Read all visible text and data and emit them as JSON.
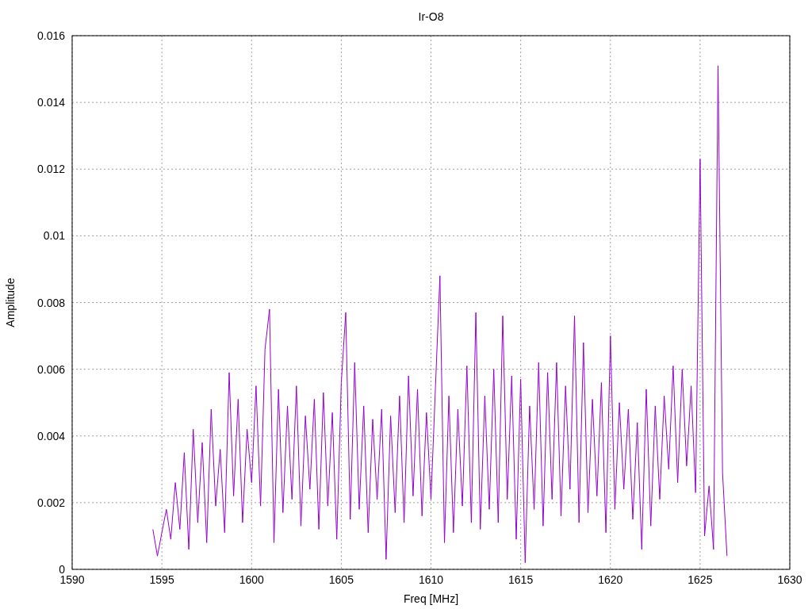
{
  "chart_data": {
    "type": "line",
    "grid": true,
    "title": "Ir-O8",
    "xlabel": "Freq [MHz]",
    "ylabel": "Amplitude",
    "xlim": [
      1590,
      1630
    ],
    "ylim": [
      0,
      0.016
    ],
    "xticks": [
      1590,
      1595,
      1600,
      1605,
      1610,
      1615,
      1620,
      1625,
      1630
    ],
    "yticks": [
      {
        "value": 0,
        "label": "0"
      },
      {
        "value": 0.002,
        "label": "0.002"
      },
      {
        "value": 0.004,
        "label": "0.004"
      },
      {
        "value": 0.006,
        "label": "0.006"
      },
      {
        "value": 0.008,
        "label": "0.008"
      },
      {
        "value": 0.01,
        "label": "0.01"
      },
      {
        "value": 0.012,
        "label": "0.012"
      },
      {
        "value": 0.014,
        "label": "0.014"
      },
      {
        "value": 0.016,
        "label": "0.016"
      }
    ],
    "x": [
      1594.5,
      1594.75,
      1595,
      1595.25,
      1595.5,
      1595.75,
      1596,
      1596.25,
      1596.5,
      1596.75,
      1597,
      1597.25,
      1597.5,
      1597.75,
      1598,
      1598.25,
      1598.5,
      1598.75,
      1599,
      1599.25,
      1599.5,
      1599.75,
      1600,
      1600.25,
      1600.5,
      1600.75,
      1601,
      1601.25,
      1601.5,
      1601.75,
      1602,
      1602.25,
      1602.5,
      1602.75,
      1603,
      1603.25,
      1603.5,
      1603.75,
      1604,
      1604.25,
      1604.5,
      1604.75,
      1605,
      1605.25,
      1605.5,
      1605.75,
      1606,
      1606.25,
      1606.5,
      1606.75,
      1607,
      1607.25,
      1607.5,
      1607.75,
      1608,
      1608.25,
      1608.5,
      1608.75,
      1609,
      1609.25,
      1609.5,
      1609.75,
      1610,
      1610.25,
      1610.5,
      1610.75,
      1611,
      1611.25,
      1611.5,
      1611.75,
      1612,
      1612.25,
      1612.5,
      1612.75,
      1613,
      1613.25,
      1613.5,
      1613.75,
      1614,
      1614.25,
      1614.5,
      1614.75,
      1615,
      1615.25,
      1615.5,
      1615.75,
      1616,
      1616.25,
      1616.5,
      1616.75,
      1617,
      1617.25,
      1617.5,
      1617.75,
      1618,
      1618.25,
      1618.5,
      1618.75,
      1619,
      1619.25,
      1619.5,
      1619.75,
      1620,
      1620.25,
      1620.5,
      1620.75,
      1621,
      1621.25,
      1621.5,
      1621.75,
      1622,
      1622.25,
      1622.5,
      1622.75,
      1623,
      1623.25,
      1623.5,
      1623.75,
      1624,
      1624.25,
      1624.5,
      1624.75,
      1625,
      1625.25,
      1625.5,
      1625.75,
      1626,
      1626.25,
      1626.5
    ],
    "series": [
      {
        "color": "#9400d3",
        "values": [
          0.0012,
          0.0004,
          0.0011,
          0.0018,
          0.0009,
          0.0026,
          0.0012,
          0.0035,
          0.0006,
          0.0042,
          0.0014,
          0.0038,
          0.0008,
          0.0048,
          0.0019,
          0.0036,
          0.0011,
          0.0059,
          0.0022,
          0.0051,
          0.0014,
          0.0042,
          0.0026,
          0.0055,
          0.0019,
          0.0066,
          0.0078,
          0.0008,
          0.0054,
          0.0017,
          0.0049,
          0.0021,
          0.0055,
          0.0013,
          0.0046,
          0.0024,
          0.0051,
          0.0012,
          0.0053,
          0.0019,
          0.0047,
          0.0009,
          0.0056,
          0.0077,
          0.0015,
          0.0062,
          0.0018,
          0.0049,
          0.0011,
          0.0045,
          0.0021,
          0.0048,
          0.0003,
          0.0046,
          0.0017,
          0.0052,
          0.0014,
          0.0058,
          0.0022,
          0.0054,
          0.0016,
          0.0047,
          0.0021,
          0.0055,
          0.0088,
          0.0008,
          0.0052,
          0.0011,
          0.0048,
          0.0019,
          0.0061,
          0.0014,
          0.0077,
          0.0012,
          0.0052,
          0.0018,
          0.006,
          0.0014,
          0.0076,
          0.0021,
          0.0058,
          0.0009,
          0.0057,
          0.0002,
          0.0049,
          0.0018,
          0.0062,
          0.0013,
          0.0059,
          0.0021,
          0.0062,
          0.0016,
          0.0055,
          0.0024,
          0.0076,
          0.0014,
          0.0068,
          0.0017,
          0.0051,
          0.0022,
          0.0056,
          0.0011,
          0.007,
          0.0018,
          0.005,
          0.0024,
          0.0048,
          0.0015,
          0.0044,
          0.0006,
          0.0054,
          0.0013,
          0.0049,
          0.0021,
          0.0052,
          0.003,
          0.0061,
          0.0026,
          0.006,
          0.0031,
          0.0055,
          0.0023,
          0.0123,
          0.001,
          0.0025,
          0.0006,
          0.0151,
          0.0029,
          0.0004
        ]
      }
    ]
  }
}
